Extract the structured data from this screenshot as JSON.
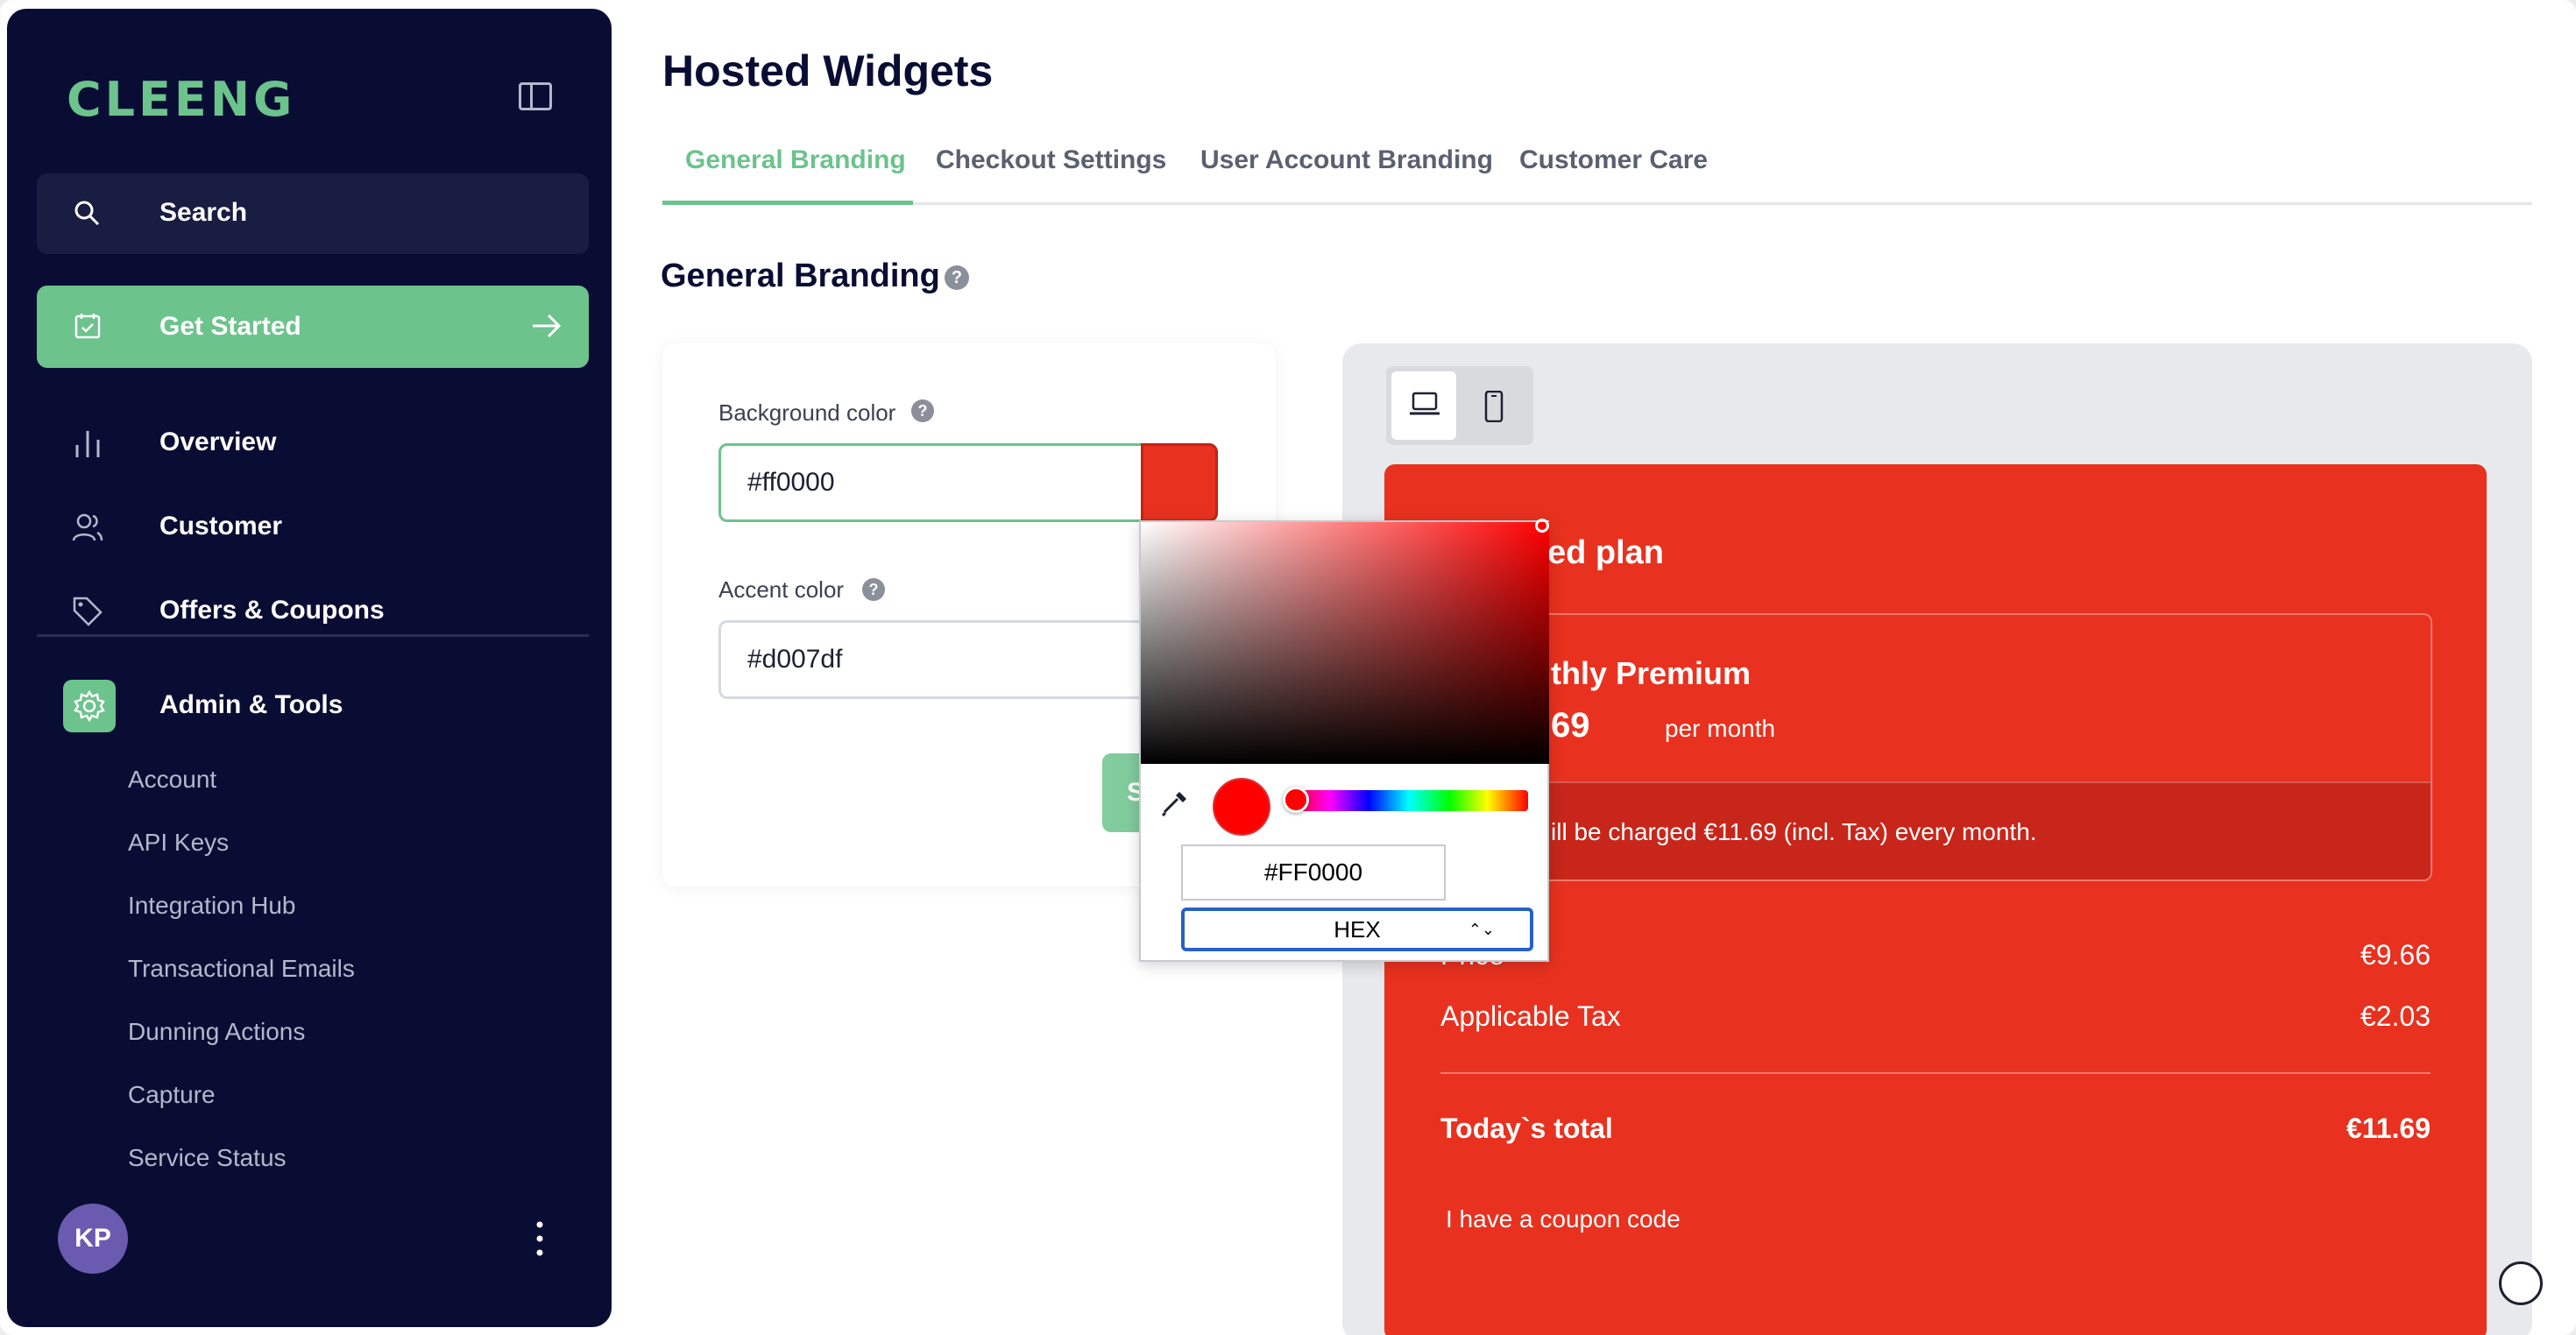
{
  "sidebar": {
    "logo": "CLEENG",
    "search_label": "Search",
    "get_started_label": "Get Started",
    "items": [
      {
        "label": "Overview",
        "icon": "bar-chart-icon"
      },
      {
        "label": "Customer",
        "icon": "users-icon"
      },
      {
        "label": "Offers & Coupons",
        "icon": "tag-icon"
      },
      {
        "label": "Admin & Tools",
        "icon": "gear-icon"
      }
    ],
    "sub_items": [
      "Account",
      "API Keys",
      "Integration Hub",
      "Transactional Emails",
      "Dunning Actions",
      "Capture",
      "Service Status"
    ],
    "user_initials": "KP"
  },
  "main": {
    "title": "Hosted Widgets",
    "tabs": [
      {
        "label": "General Branding",
        "active": true
      },
      {
        "label": "Checkout Settings",
        "active": false
      },
      {
        "label": "User Account Branding",
        "active": false
      },
      {
        "label": "Customer Care",
        "active": false
      }
    ],
    "section_title": "General Branding",
    "help_glyph": "?",
    "form": {
      "background_label": "Background color",
      "background_value": "#ff0000",
      "accent_label": "Accent color",
      "accent_value": "#d007df",
      "save_label": "S"
    },
    "picker": {
      "hex_value": "#FF0000",
      "mode": "HEX",
      "mode_chevron": "⌃⌄"
    }
  },
  "widget": {
    "title": "ed plan",
    "offer_name": "thly Premium",
    "offer_price": "69",
    "offer_period": "per month",
    "offer_note": "ill be charged €11.69 (incl. Tax) every month.",
    "price_label": "Price",
    "price_value": "€9.66",
    "tax_label": "Applicable Tax",
    "tax_value": "€2.03",
    "total_label": "Today`s total",
    "total_value": "€11.69",
    "coupon_label": "I have a coupon code"
  },
  "colors": {
    "sidebar_bg": "#0a0d33",
    "accent_green": "#6cc38c",
    "widget_red": "#e8311f",
    "accent_purple": "#d007df"
  }
}
